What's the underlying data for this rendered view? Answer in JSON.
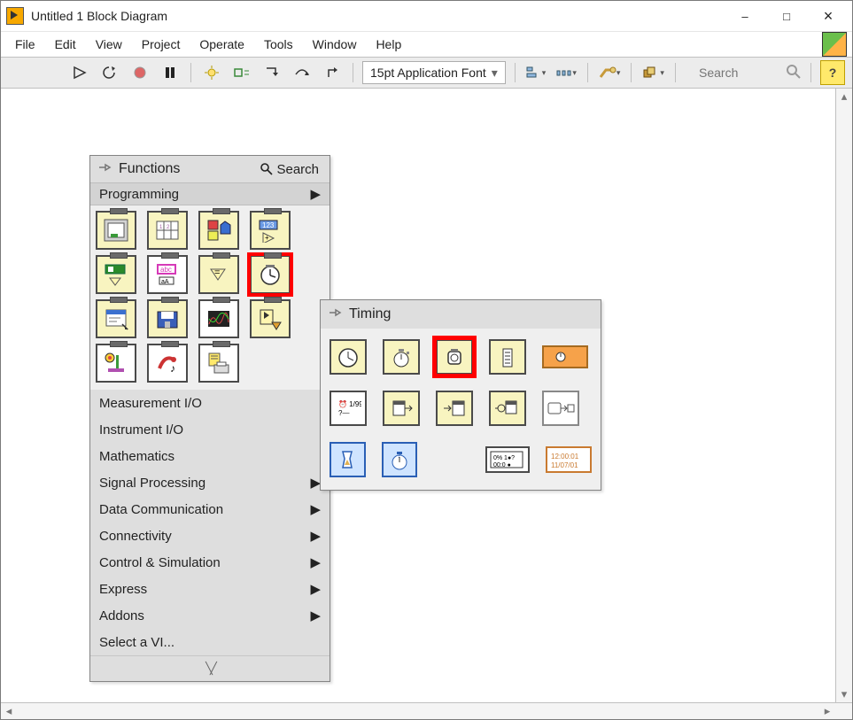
{
  "window": {
    "title": "Untitled 1 Block Diagram",
    "buttons": {
      "min": "–",
      "max": "□",
      "close": "×"
    }
  },
  "menu": {
    "items": [
      "File",
      "Edit",
      "View",
      "Project",
      "Operate",
      "Tools",
      "Window",
      "Help"
    ]
  },
  "toolbar": {
    "font": "15pt Application Font",
    "search_placeholder": "Search",
    "help": "?",
    "buttons": {
      "run": "run-arrow",
      "run_continuous": "run-continuous",
      "abort": "abort",
      "pause": "pause",
      "highlight": "highlight-execution",
      "retain": "retain-wire-values",
      "step_into": "step-into",
      "step_over": "step-over",
      "step_out": "step-out",
      "align": "align-objects",
      "distribute": "distribute-objects",
      "reorder": "reorder",
      "cleanup": "cleanup-diagram"
    }
  },
  "functions_palette": {
    "title": "Functions",
    "search": "Search",
    "open_category": "Programming",
    "grid": [
      [
        "structures",
        "array",
        "cluster-class",
        "numeric"
      ],
      [
        "boolean",
        "string",
        "comparison",
        "timing"
      ],
      [
        "dialog-ui",
        "file-io",
        "waveform",
        "application-control"
      ],
      [
        "synchronization",
        "graphics-sound",
        "report-generation",
        null
      ]
    ],
    "highlight": "timing",
    "categories": [
      {
        "label": "Measurement I/O",
        "submenu": false
      },
      {
        "label": "Instrument I/O",
        "submenu": false
      },
      {
        "label": "Mathematics",
        "submenu": false
      },
      {
        "label": "Signal Processing",
        "submenu": true
      },
      {
        "label": "Data Communication",
        "submenu": true
      },
      {
        "label": "Connectivity",
        "submenu": true
      },
      {
        "label": "Control & Simulation",
        "submenu": true
      },
      {
        "label": "Express",
        "submenu": true
      },
      {
        "label": "Addons",
        "submenu": true
      },
      {
        "label": "Select a VI...",
        "submenu": false
      }
    ]
  },
  "timing_palette": {
    "title": "Timing",
    "grid": [
      [
        "tick-count",
        "wait-ms",
        "wait-until-next-ms",
        "high-res-timer",
        "time-delay"
      ],
      [
        "get-date-time-seconds",
        "seconds-to-date-time",
        "date-time-to-seconds",
        "to-time-stamp",
        "format-date-time-string"
      ],
      [
        "elapsed-time",
        "stall-data-flow",
        null,
        "time-stamp-constant",
        "date-time-string"
      ]
    ],
    "highlight": "wait-until-next-ms"
  }
}
